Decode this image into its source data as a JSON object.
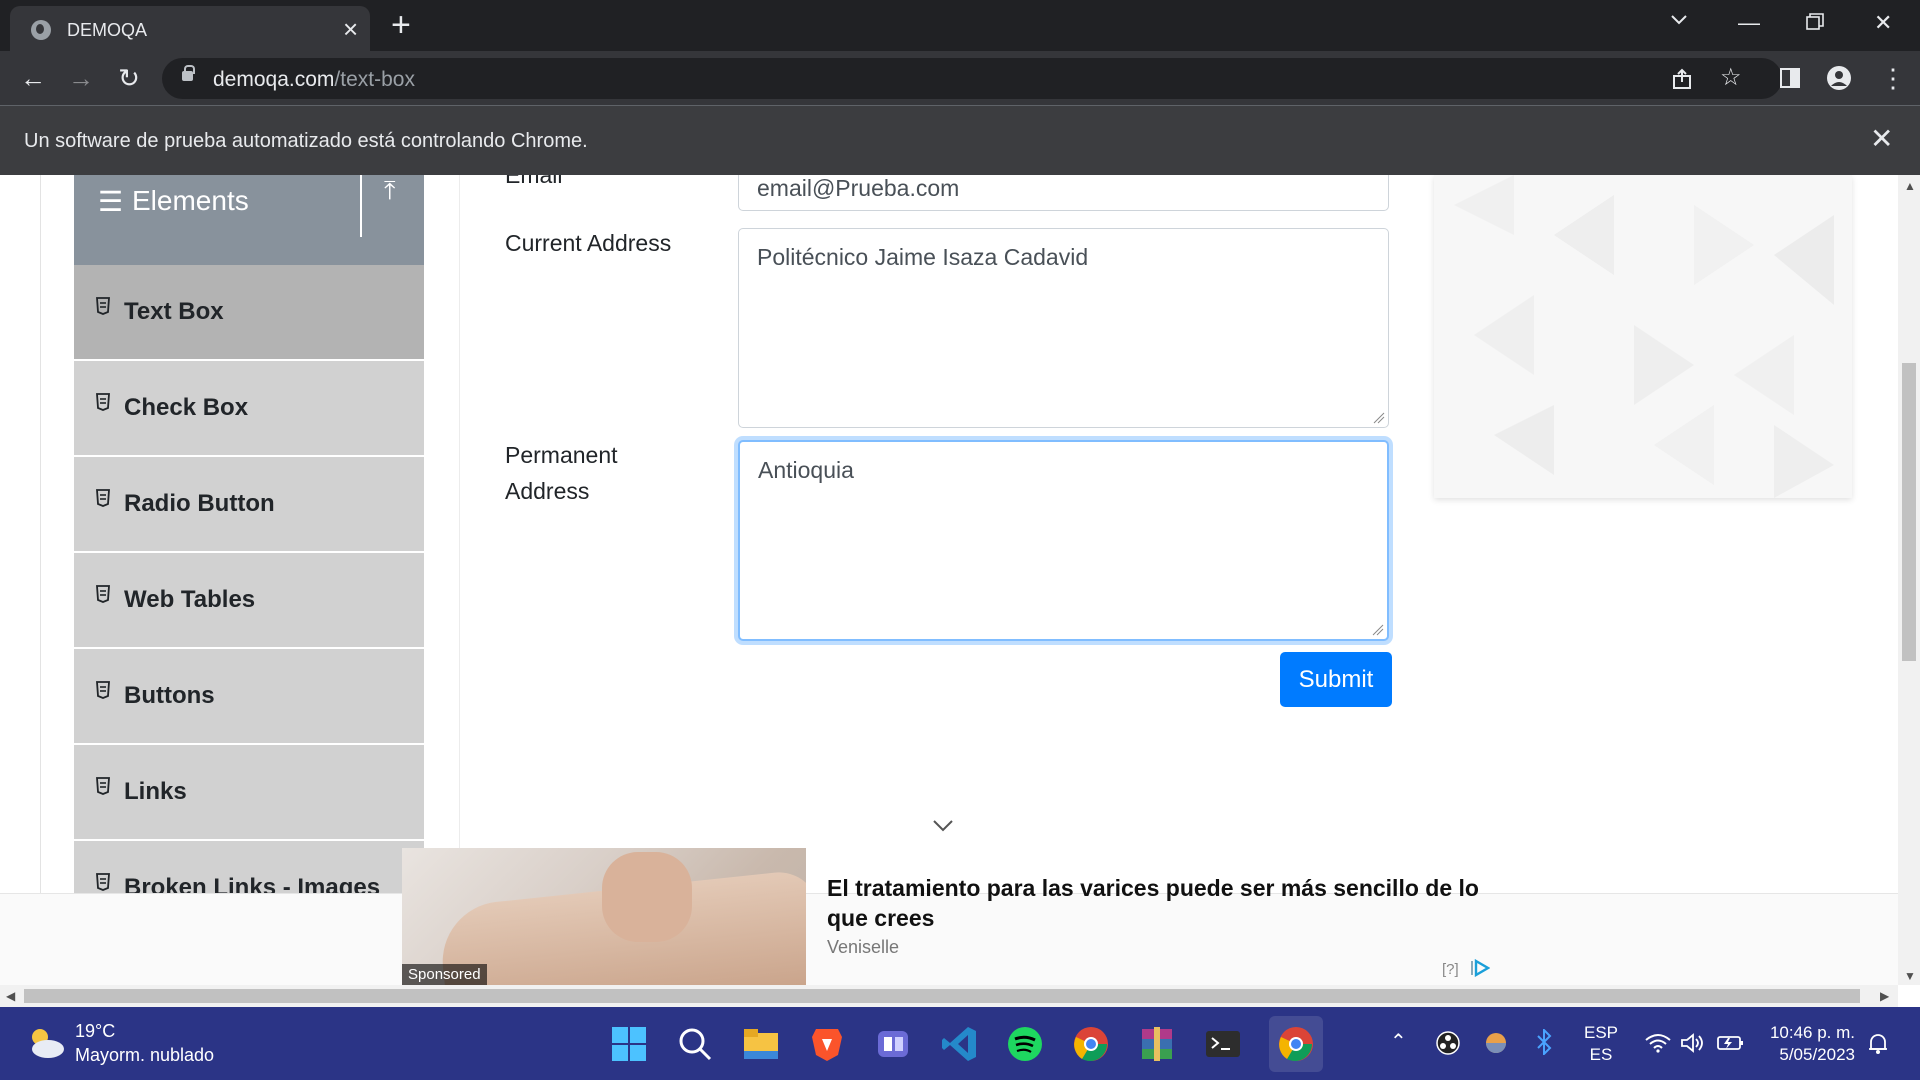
{
  "browser": {
    "tab_title": "DEMOQA",
    "url_domain": "demoqa.com",
    "url_path": "/text-box",
    "infobar_text": "Un software de prueba automatizado está controlando Chrome."
  },
  "sidebar": {
    "group_title": "Elements",
    "items": [
      {
        "label": "Text Box",
        "active": true
      },
      {
        "label": "Check Box"
      },
      {
        "label": "Radio Button"
      },
      {
        "label": "Web Tables"
      },
      {
        "label": "Buttons"
      },
      {
        "label": "Links"
      },
      {
        "label": "Broken Links - Images"
      }
    ]
  },
  "form": {
    "email_label": "Email",
    "email_value": "email@Prueba.com",
    "current_address_label": "Current Address",
    "current_address_value": "Politécnico Jaime Isaza Cadavid",
    "permanent_address_label_1": "Permanent",
    "permanent_address_label_2": "Address",
    "permanent_address_value": "Antioquia",
    "submit_label": "Submit"
  },
  "ad": {
    "headline": "El tratamiento para las varices puede ser más sencillo de lo que crees",
    "source": "Veniselle",
    "sponsored": "Sponsored",
    "info": "[?]"
  },
  "taskbar": {
    "temperature": "19°C",
    "weather": "Mayorm. nublado",
    "lang_1": "ESP",
    "lang_2": "ES",
    "time": "10:46 p. m.",
    "date": "5/05/2023"
  },
  "colors": {
    "primary": "#007bff",
    "sidebar_active": "#b3b3b3",
    "sidebar_item": "#d1d1d1",
    "taskbar": "#2b3486"
  }
}
